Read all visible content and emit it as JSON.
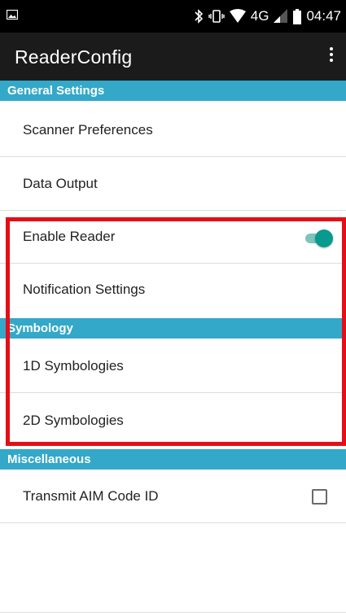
{
  "status_bar": {
    "network": "4G",
    "time": "04:47",
    "icons": [
      "image-icon",
      "bluetooth-icon",
      "vibrate-icon",
      "wifi-icon",
      "signal-icon",
      "battery-icon"
    ]
  },
  "app_bar": {
    "title": "ReaderConfig",
    "overflow_icon": "more-vert-icon"
  },
  "sections": {
    "general": {
      "header": "General Settings",
      "items": {
        "scanner_preferences": "Scanner Preferences",
        "data_output": "Data Output",
        "enable_reader": "Enable Reader",
        "notification_settings": "Notification Settings"
      },
      "enable_reader_on": true
    },
    "symbology": {
      "header": "Symbology",
      "items": {
        "symbologies_1d": "1D Symbologies",
        "symbologies_2d": "2D Symbologies"
      }
    },
    "misc": {
      "header": "Miscellaneous",
      "items": {
        "transmit_aim": "Transmit AIM Code ID"
      },
      "transmit_aim_checked": false
    }
  },
  "colors": {
    "section_header": "#33a8c9",
    "toggle_on": "#089a8e",
    "highlight": "#e60e16",
    "app_bar": "#1b1b1b"
  }
}
